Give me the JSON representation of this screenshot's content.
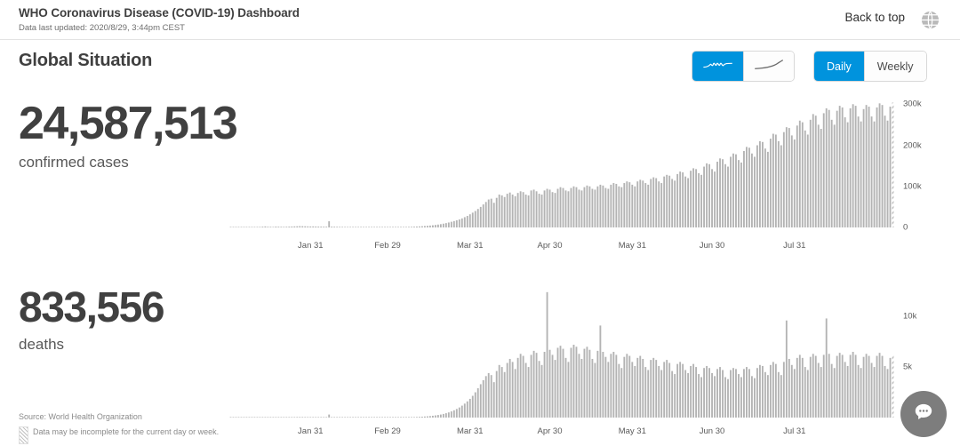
{
  "header": {
    "title": "WHO Coronavirus Disease (COVID-19) Dashboard",
    "last_updated": "Data last updated: 2020/8/29, 3:44pm CEST",
    "back_to_top": "Back to top",
    "globe_icon": "globe-icon"
  },
  "section": {
    "title": "Global Situation"
  },
  "controls": {
    "chart_type": {
      "options": [
        {
          "id": "daily-bars",
          "icon": "wave-line-icon",
          "active": true
        },
        {
          "id": "cumulative-curve",
          "icon": "curve-line-icon",
          "active": false
        }
      ]
    },
    "interval": {
      "options": [
        {
          "id": "daily",
          "label": "Daily",
          "active": true
        },
        {
          "id": "weekly",
          "label": "Weekly",
          "active": false
        }
      ]
    },
    "active_color": "#0093dd",
    "inactive_color": "#fdfdfd"
  },
  "stats": [
    {
      "id": "confirmed",
      "value": "24,587,513",
      "label": "confirmed cases"
    },
    {
      "id": "deaths",
      "value": "833,556",
      "label": "deaths"
    }
  ],
  "footer": {
    "source": "Source: World Health Organization",
    "note": "Data may be incomplete for the current day or week.",
    "swatch_icon": "hatch-pattern-swatch"
  },
  "chat": {
    "icon": "chat-bubble-icon",
    "color": "#7d7d7d"
  },
  "chart_data": [
    {
      "id": "confirmed-cases-chart",
      "type": "bar",
      "title": "",
      "xlabel": "",
      "ylabel": "",
      "ylim": [
        0,
        320000
      ],
      "grid": false,
      "bar_color": "#b3b3b3",
      "incomplete_bar_note": "last bar hatched — incomplete current day",
      "tick_labels": [
        "Jan 31",
        "Feb 29",
        "Mar 31",
        "Apr 30",
        "May 31",
        "Jun 30",
        "Jul 31"
      ],
      "tick_indices": [
        30,
        59,
        90,
        120,
        151,
        181,
        212
      ],
      "ytick_labels": [
        "0",
        "100k",
        "200k",
        "300k"
      ],
      "ytick_values": [
        0,
        100000,
        200000,
        300000
      ],
      "x_start": "2020-01-01",
      "x_end": "2020-08-29",
      "values": [
        200,
        260,
        320,
        400,
        480,
        560,
        640,
        700,
        800,
        900,
        1000,
        1400,
        1900,
        2500,
        1700,
        1500,
        1300,
        2100,
        1800,
        1600,
        1500,
        1700,
        2000,
        2300,
        2600,
        2900,
        3200,
        3000,
        2800,
        2600,
        2400,
        2500,
        2300,
        2100,
        2000,
        1900,
        1800,
        15000,
        2000,
        1800,
        1600,
        1500,
        1400,
        1300,
        1200,
        1100,
        1000,
        900,
        850,
        800,
        750,
        700,
        680,
        660,
        640,
        620,
        600,
        580,
        560,
        540,
        600,
        700,
        800,
        900,
        1000,
        1100,
        1200,
        1400,
        1600,
        1900,
        2200,
        2600,
        3000,
        3500,
        4000,
        4600,
        5300,
        6100,
        7000,
        8000,
        9200,
        10500,
        12000,
        13800,
        15500,
        17500,
        19500,
        22000,
        25000,
        28000,
        32000,
        36000,
        40000,
        45000,
        50000,
        56000,
        62000,
        68000,
        70000,
        60000,
        72000,
        80000,
        78000,
        74000,
        82000,
        85000,
        80000,
        76000,
        84000,
        88000,
        86000,
        80000,
        78000,
        90000,
        92000,
        88000,
        82000,
        80000,
        90000,
        94000,
        92000,
        86000,
        84000,
        94000,
        98000,
        96000,
        90000,
        88000,
        96000,
        100000,
        98000,
        92000,
        90000,
        98000,
        102000,
        100000,
        94000,
        92000,
        100000,
        104000,
        102000,
        96000,
        94000,
        104000,
        108000,
        106000,
        100000,
        98000,
        108000,
        112000,
        110000,
        104000,
        100000,
        112000,
        116000,
        114000,
        108000,
        104000,
        118000,
        122000,
        120000,
        112000,
        108000,
        124000,
        128000,
        126000,
        118000,
        114000,
        130000,
        136000,
        134000,
        124000,
        120000,
        138000,
        144000,
        142000,
        132000,
        128000,
        148000,
        156000,
        154000,
        142000,
        136000,
        160000,
        168000,
        166000,
        154000,
        148000,
        172000,
        180000,
        178000,
        164000,
        158000,
        186000,
        196000,
        194000,
        180000,
        172000,
        200000,
        210000,
        208000,
        192000,
        184000,
        216000,
        228000,
        226000,
        210000,
        200000,
        232000,
        244000,
        242000,
        224000,
        214000,
        248000,
        260000,
        256000,
        236000,
        226000,
        262000,
        276000,
        272000,
        250000,
        240000,
        278000,
        290000,
        286000,
        262000,
        250000,
        284000,
        296000,
        292000,
        268000,
        256000,
        290000,
        300000,
        296000,
        270000,
        258000,
        288000,
        298000,
        294000,
        270000,
        258000,
        292000,
        302000,
        298000,
        272000,
        260000,
        294000,
        304000
      ]
    },
    {
      "id": "deaths-chart",
      "type": "bar",
      "title": "",
      "xlabel": "",
      "ylabel": "",
      "ylim": [
        0,
        13000
      ],
      "grid": false,
      "bar_color": "#b3b3b3",
      "incomplete_bar_note": "last bar hatched — incomplete current day",
      "tick_labels": [
        "Jan 31",
        "Feb 29",
        "Mar 31",
        "Apr 30",
        "May 31",
        "Jun 30",
        "Jul 31"
      ],
      "tick_indices": [
        30,
        59,
        90,
        120,
        151,
        181,
        212
      ],
      "ytick_labels": [
        "5k",
        "10k"
      ],
      "ytick_values": [
        5000,
        10000
      ],
      "x_start": "2020-01-01",
      "x_end": "2020-08-29",
      "values": [
        5,
        6,
        8,
        10,
        12,
        14,
        16,
        18,
        20,
        24,
        28,
        34,
        40,
        46,
        52,
        44,
        38,
        46,
        42,
        38,
        36,
        40,
        44,
        48,
        52,
        56,
        60,
        58,
        54,
        50,
        48,
        46,
        44,
        42,
        40,
        38,
        36,
        300,
        40,
        38,
        36,
        34,
        32,
        30,
        28,
        26,
        24,
        22,
        21,
        20,
        19,
        18,
        17,
        16,
        16,
        15,
        15,
        14,
        14,
        13,
        14,
        16,
        18,
        20,
        24,
        28,
        32,
        38,
        44,
        52,
        62,
        74,
        88,
        105,
        125,
        150,
        180,
        215,
        255,
        300,
        360,
        430,
        510,
        610,
        720,
        850,
        1000,
        1180,
        1380,
        1600,
        1850,
        2150,
        2500,
        2900,
        3300,
        3700,
        4100,
        4400,
        4200,
        3500,
        4600,
        5200,
        5000,
        4500,
        5400,
        5800,
        5500,
        4800,
        5900,
        6300,
        6100,
        5400,
        5000,
        6200,
        6600,
        6400,
        5600,
        5200,
        6500,
        12400,
        6700,
        6200,
        5700,
        6900,
        7100,
        6800,
        5900,
        5500,
        6900,
        7200,
        7000,
        6300,
        5800,
        6800,
        7000,
        6700,
        5800,
        5400,
        6600,
        9100,
        6500,
        6000,
        5500,
        6300,
        6500,
        6200,
        5300,
        4900,
        6000,
        6300,
        6100,
        5500,
        5100,
        5900,
        6100,
        5800,
        5000,
        4700,
        5700,
        5900,
        5700,
        5100,
        4700,
        5500,
        5700,
        5400,
        4600,
        4300,
        5300,
        5500,
        5300,
        4700,
        4400,
        5100,
        5300,
        5000,
        4300,
        4000,
        4900,
        5100,
        4900,
        4400,
        4100,
        4800,
        5000,
        4700,
        4000,
        3800,
        4700,
        4900,
        4800,
        4300,
        4000,
        4800,
        5000,
        4800,
        4100,
        3900,
        4900,
        5200,
        5100,
        4500,
        4200,
        5200,
        5500,
        5300,
        4500,
        4200,
        5500,
        9600,
        5800,
        5200,
        4800,
        5900,
        6200,
        5900,
        5000,
        4700,
        6000,
        6300,
        6100,
        5400,
        5000,
        6200,
        9800,
        6300,
        5300,
        4900,
        6100,
        6400,
        6200,
        5500,
        5100,
        6200,
        6500,
        6200,
        5200,
        4900,
        6000,
        6300,
        6100,
        5400,
        5000,
        6100,
        6400,
        6100,
        5100,
        4800,
        5900,
        6200
      ]
    }
  ]
}
